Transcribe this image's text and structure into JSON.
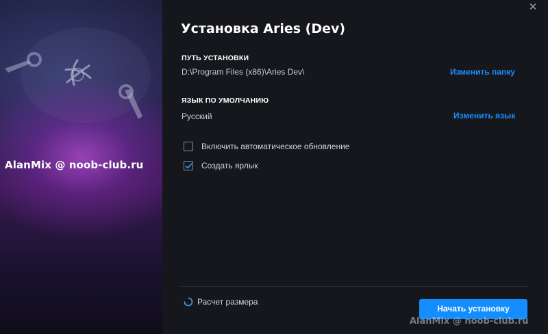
{
  "window": {
    "close_glyph": "✕"
  },
  "hero": {
    "watermark": "AlanMix @ noob-club.ru",
    "icons": [
      "wrench-icon",
      "battlenet-logo-icon",
      "wrench-icon"
    ]
  },
  "header": {
    "title": "Установка Aries (Dev)"
  },
  "install_path": {
    "label": "ПУТЬ УСТАНОВКИ",
    "value": "D:\\Program Files (x86)\\Aries Dev\\",
    "change_link": "Изменить папку"
  },
  "language": {
    "label": "ЯЗЫК ПО УМОЛЧАНИЮ",
    "value": "Русский",
    "change_link": "Изменить язык"
  },
  "options": [
    {
      "label": "Включить автоматическое обновление",
      "checked": false
    },
    {
      "label": "Создать ярлык",
      "checked": true
    }
  ],
  "footer": {
    "size_status": "Расчет размера",
    "install_button": "Начать установку",
    "watermark": "AlanMix @ noob-club.ru"
  },
  "colors": {
    "accent": "#148eff",
    "link": "#1a8fff",
    "background": "#15171c"
  }
}
